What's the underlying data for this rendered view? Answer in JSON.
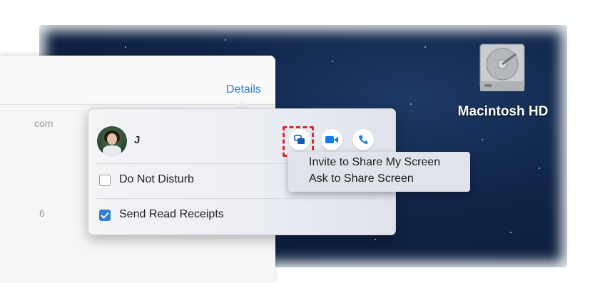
{
  "desktop": {
    "drive_label": "Macintosh HD",
    "drive_icon": "hard-drive-icon"
  },
  "background_window": {
    "details_link": "Details",
    "fragment_1": "com",
    "fragment_2": "6"
  },
  "popover": {
    "contact_name": "J",
    "actions": [
      {
        "name": "share-screen",
        "icon": "share-screen-icon"
      },
      {
        "name": "video",
        "icon": "video-camera-icon"
      },
      {
        "name": "phone",
        "icon": "phone-icon"
      }
    ],
    "do_not_disturb_label": "Do Not Disturb",
    "do_not_disturb_checked": false,
    "read_receipts_label": "Send Read Receipts",
    "read_receipts_checked": true
  },
  "share_menu": {
    "items": [
      "Invite to Share My Screen",
      "Ask to Share Screen"
    ]
  },
  "colors": {
    "accent": "#2f7fd6",
    "highlight": "#e3242b",
    "desktop": "#0f2447"
  }
}
